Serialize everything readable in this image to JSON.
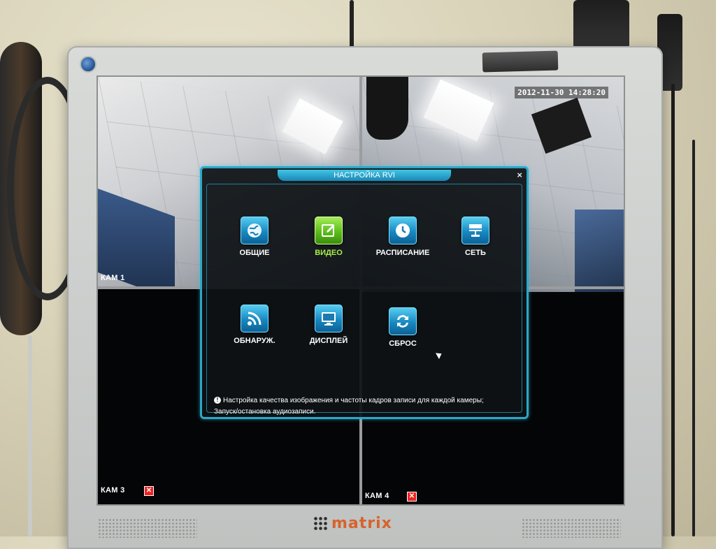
{
  "monitor": {
    "brand": "matrix"
  },
  "screen": {
    "timestamp": "2012-11-30 14:28:20",
    "cameras": [
      {
        "label": "КАМ 1",
        "signal": true
      },
      {
        "label": "",
        "signal": true
      },
      {
        "label": "КАМ 3",
        "signal": false
      },
      {
        "label": "КАМ 4",
        "signal": false
      }
    ],
    "no_signal_mark": "✕"
  },
  "dialog": {
    "title": "НАСТРОЙКА RVI",
    "close": "×",
    "accent": "#2aa8c8",
    "items": [
      {
        "label": "ОБЩИЕ",
        "icon": "globe-icon",
        "active": false
      },
      {
        "label": "ВИДЕО",
        "icon": "edit-icon",
        "active": true
      },
      {
        "label": "РАСПИСАНИЕ",
        "icon": "clock-icon",
        "active": false
      },
      {
        "label": "СЕТЬ",
        "icon": "network-icon",
        "active": false
      },
      {
        "label": "ОБНАРУЖ.",
        "icon": "signal-icon",
        "active": false
      },
      {
        "label": "ДИСПЛЕЙ",
        "icon": "monitor-icon",
        "active": false
      },
      {
        "label": "СБРОС",
        "icon": "refresh-icon",
        "active": false
      }
    ],
    "help": {
      "line1": "Настройка качества изображения и частоты кадров записи для каждой камеры;",
      "line2": "Запуск/остановка аудиозаписи.",
      "icon": "info-icon"
    }
  },
  "colors": {
    "active_item": "#a8f04a",
    "brand": "#d8632c",
    "no_signal": "#e22222"
  }
}
